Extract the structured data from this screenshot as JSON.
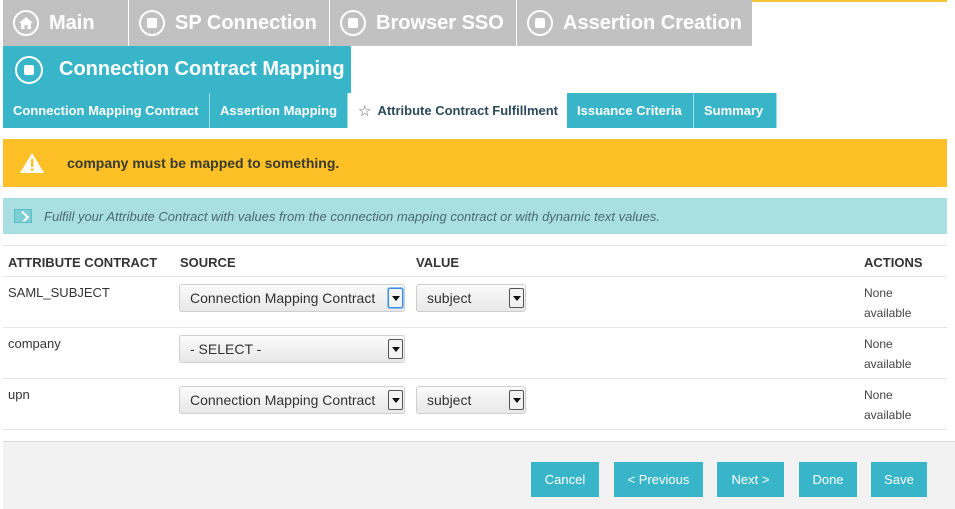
{
  "top_nav": {
    "items": [
      {
        "label": "Main",
        "icon": "home-icon"
      },
      {
        "label": "SP Connection",
        "icon": "circle-square-icon"
      },
      {
        "label": "Browser SSO",
        "icon": "circle-square-icon"
      },
      {
        "label": "Assertion Creation",
        "icon": "circle-square-icon"
      }
    ]
  },
  "current_page": {
    "title": "Connection Contract Mapping",
    "icon": "circle-square-icon"
  },
  "sub_tabs": [
    {
      "label": "Connection Mapping Contract"
    },
    {
      "label": "Assertion Mapping"
    },
    {
      "label": "Attribute Contract Fulfillment",
      "active": true,
      "icon": "star-icon"
    },
    {
      "label": "Issuance Criteria"
    },
    {
      "label": "Summary"
    }
  ],
  "warning": {
    "text": "company must be mapped to something.",
    "icon": "warning-triangle-icon"
  },
  "info": {
    "text": "Fulfill your Attribute Contract with values from the connection mapping contract or with dynamic text values.",
    "icon": "info-box-icon"
  },
  "table": {
    "headers": {
      "attribute": "ATTRIBUTE CONTRACT",
      "source": "SOURCE",
      "value": "VALUE",
      "actions": "ACTIONS"
    },
    "rows": [
      {
        "attribute": "SAML_SUBJECT",
        "source": "Connection Mapping Contract",
        "value": "subject",
        "actions": "None available"
      },
      {
        "attribute": "company",
        "source": "- SELECT -",
        "value": "",
        "actions": "None available"
      },
      {
        "attribute": "upn",
        "source": "Connection Mapping Contract",
        "value": "subject",
        "actions": "None available"
      }
    ]
  },
  "footer": {
    "cancel": "Cancel",
    "previous": "< Previous",
    "next": "Next >",
    "done": "Done",
    "save": "Save"
  },
  "colors": {
    "teal": "#38b5c9",
    "gray_tab": "#c1c1c1",
    "warning": "#fdc127",
    "info": "#a9dfe0"
  }
}
